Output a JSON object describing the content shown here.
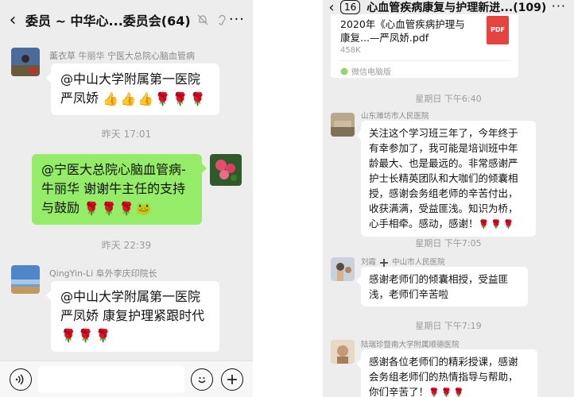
{
  "left": {
    "header": {
      "title": "委员 ~ 中华心...委员会(64)"
    },
    "messages": [
      {
        "sender": "薰衣草  牛丽华 宁医大总院心脑血管病",
        "text": "@中山大学附属第一医院\n严凤娇",
        "emoji": [
          "👍",
          "👍",
          "👍",
          "🌹",
          "🌹",
          "🌹"
        ]
      },
      {
        "time": "昨天 17:01"
      },
      {
        "text": "@宁医大总院心脑血管病-\n牛丽华  谢谢牛主任的支持\n与鼓励",
        "emoji": [
          "🌹",
          "🌹",
          "🌹",
          "🐸"
        ]
      },
      {
        "time": "昨天 22:39"
      },
      {
        "sender": "QingYin-Li  阜外李庆印院长",
        "text": "@中山大学附属第一医院\n严凤娇  康复护理紧跟时代",
        "emoji": [
          "🌹",
          "🌹",
          "🌹"
        ]
      }
    ]
  },
  "right": {
    "header": {
      "badge": "16",
      "title": "心血管疾病康复与护理新进...(109)"
    },
    "file": {
      "name": "2020年《心血管疾病护理与康复...—严凤娇.pdf",
      "size": "458K",
      "type": "PDF",
      "source": "微信电脑版"
    },
    "messages": [
      {
        "time": "星期日 下午6:40"
      },
      {
        "sender": "山东潍坊市人民医院",
        "text": "关注这个学习班三年了，今年终于\n有幸参加了，我可能是培训班中年\n龄最大、也是最远的。非常感谢严\n护士长精英团队和大咖们的倾囊相\n授，感谢会务组老师的辛苦付出，\n收获满满，受益匪浅。知识为桥，\n心手相牵。感动，感谢！",
        "emoji": [
          "🌹",
          "🌹",
          "🌹"
        ]
      },
      {
        "time": "星期日 下午7:05"
      },
      {
        "sender_a": "刘霞",
        "sender_b": "中山市人民医院",
        "text": "感谢老师们的倾囊相授，受益匪\n浅，老师们辛苦啦"
      },
      {
        "time": "星期日 下午7:19"
      },
      {
        "sender": "陆瑞珍暨南大学附属顺德医院",
        "text": "感谢各位老师们的精彩授课，感谢\n会务组老师们的热情指导与帮助，\n你们辛苦了！",
        "emoji": [
          "🌹",
          "🌹",
          "🌹"
        ]
      }
    ]
  }
}
